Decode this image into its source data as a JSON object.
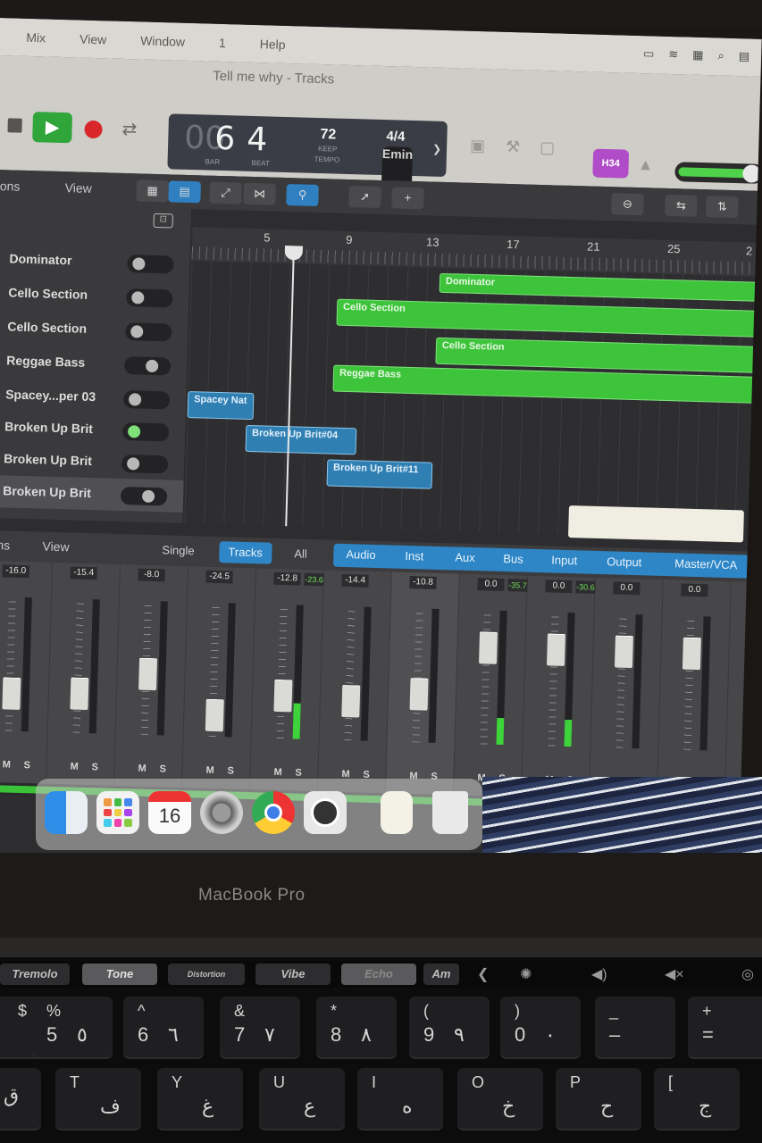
{
  "menubar": {
    "items": [
      "Mix",
      "View",
      "Window",
      "1",
      "Help"
    ]
  },
  "window": {
    "title": "Tell me why - Tracks"
  },
  "lcd": {
    "bar_prefix": "00",
    "bar": "6",
    "beat": "4",
    "bar_caption": "BAR",
    "beat_caption": "BEAT",
    "tempo": "72",
    "tempo_caption": "KEEP",
    "tempo_sub": "TEMPO",
    "time_signature": "4/4",
    "key": "Emin"
  },
  "user_badge": "H34",
  "tracks_toolbar": {
    "edit_label": "ions",
    "view_label": "View"
  },
  "ruler": {
    "bars": [
      "5",
      "9",
      "13",
      "17",
      "21",
      "25",
      "2"
    ]
  },
  "tracks": [
    {
      "name": "Dominator"
    },
    {
      "name": "Cello Section"
    },
    {
      "name": "Cello Section"
    },
    {
      "name": "Reggae Bass"
    },
    {
      "name": "Spacey...per 03"
    },
    {
      "name": "Broken Up Brit"
    },
    {
      "name": "Broken Up Brit"
    },
    {
      "name": "Broken Up Brit"
    }
  ],
  "regions": [
    {
      "label": "Dominator"
    },
    {
      "label": "Cello Section"
    },
    {
      "label": "Cello Section"
    },
    {
      "label": "Reggae Bass"
    },
    {
      "label": "Spacey Nat"
    },
    {
      "label": "Broken Up Brit#04"
    },
    {
      "label": "Broken Up Brit#11"
    }
  ],
  "mixer_toolbar": {
    "edit_label": "ions",
    "view_label": "View",
    "tabs": [
      "Single",
      "Tracks",
      "All"
    ],
    "selected_tab": "Tracks",
    "filters": [
      "Audio",
      "Inst",
      "Aux",
      "Bus",
      "Input",
      "Output",
      "Master/VCA"
    ]
  },
  "mixer": {
    "strips": [
      {
        "gain": "-16.0",
        "peak": ""
      },
      {
        "gain": "-15.4",
        "peak": ""
      },
      {
        "gain": "-8.0",
        "peak": ""
      },
      {
        "gain": "-24.5",
        "peak": ""
      },
      {
        "gain": "-12.8",
        "peak": "-23.6"
      },
      {
        "gain": "-14.4",
        "peak": ""
      },
      {
        "gain": "-10.8",
        "peak": ""
      },
      {
        "gain": "0.0",
        "peak": "-35.7"
      },
      {
        "gain": "0.0",
        "peak": "-30.6"
      },
      {
        "gain": "0.0",
        "peak": ""
      },
      {
        "gain": "0.0",
        "peak": ""
      }
    ],
    "mute_label": "M",
    "solo_label": "S"
  },
  "dock": {
    "calendar_day": "16"
  },
  "laptop": {
    "brand": "MacBook Pro"
  },
  "touchbar": {
    "keys": [
      "Tremolo",
      "Tone",
      "Distortion",
      "Vibe",
      "Echo",
      "Am"
    ]
  },
  "keyboard": {
    "row1": [
      {
        "top": "%",
        "bottom": "5",
        "alt": "٥"
      },
      {
        "top": "^",
        "bottom": "6",
        "alt": "٦"
      },
      {
        "top": "&",
        "bottom": "7",
        "alt": "٧"
      },
      {
        "top": "*",
        "bottom": "8",
        "alt": "٨"
      },
      {
        "top": "(",
        "bottom": "9",
        "alt": "٩"
      },
      {
        "top": ")",
        "bottom": "0",
        "alt": "٠"
      },
      {
        "top": "_",
        "bottom": "–",
        "alt": ""
      },
      {
        "top": "+",
        "bottom": "=",
        "alt": ""
      }
    ],
    "row2": [
      {
        "top": "T",
        "bottom": "ق",
        "alt": ""
      },
      {
        "top": "Y",
        "bottom": "ف",
        "alt": ""
      },
      {
        "top": "U",
        "bottom": "غ",
        "alt": ""
      },
      {
        "top": "I",
        "bottom": "ع",
        "alt": ""
      },
      {
        "top": "O",
        "bottom": "ه",
        "alt": ""
      },
      {
        "top": "P",
        "bottom": "خ",
        "alt": ""
      },
      {
        "top": "[",
        "bottom": "ح",
        "alt": ""
      },
      {
        "top": "]",
        "bottom": "ج",
        "alt": ""
      }
    ]
  }
}
